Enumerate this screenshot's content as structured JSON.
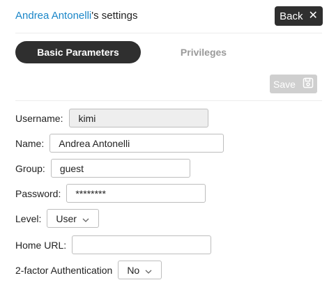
{
  "header": {
    "user_name": "Andrea Antonelli",
    "title_suffix": "'s settings",
    "back_label": "Back",
    "back_icon": "close-icon"
  },
  "tabs": [
    {
      "label": "Basic Parameters",
      "active": true
    },
    {
      "label": "Privileges",
      "active": false
    }
  ],
  "toolbar": {
    "save_label": "Save",
    "save_icon": "floppy-disk-icon"
  },
  "form": {
    "username": {
      "label": "Username:",
      "value": "kimi"
    },
    "name": {
      "label": "Name:",
      "value": "Andrea Antonelli"
    },
    "group": {
      "label": "Group:",
      "value": "guest"
    },
    "password": {
      "label": "Password:",
      "value": "********"
    },
    "level": {
      "label": "Level:",
      "value": "User"
    },
    "home_url": {
      "label": "Home URL:",
      "value": ""
    },
    "two_factor": {
      "label": "2-factor Authentication",
      "value": "No"
    }
  },
  "colors": {
    "accent": "#1a86c8",
    "dark": "#2f2f2f",
    "disabled": "#cfcfcf"
  }
}
